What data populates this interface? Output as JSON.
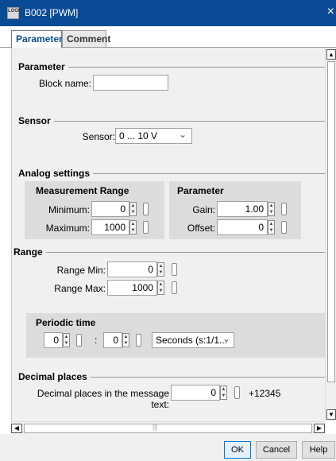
{
  "window": {
    "title": "B002 [PWM]",
    "app_icon": "LOGO",
    "close": "×"
  },
  "tabs": [
    {
      "label": "Parameter",
      "active": true
    },
    {
      "label": "Comment",
      "active": false
    }
  ],
  "sections": {
    "parameter": "Parameter",
    "sensor": "Sensor",
    "analog": "Analog settings",
    "range": "Range",
    "decimal": "Decimal places"
  },
  "fields": {
    "block_name": {
      "label": "Block name:",
      "value": ""
    },
    "sensor": {
      "label": "Sensor:",
      "value": "0 ... 10 V",
      "chevron": "⌄"
    },
    "measurement_range": {
      "title": "Measurement Range",
      "minimum": {
        "label": "Minimum:",
        "value": "0"
      },
      "maximum": {
        "label": "Maximum:",
        "value": "1000"
      }
    },
    "param_group": {
      "title": "Parameter",
      "gain": {
        "label": "Gain:",
        "value": "1.00"
      },
      "offset": {
        "label": "Offset:",
        "value": "0"
      }
    },
    "range_min": {
      "label": "Range Min:",
      "value": "0"
    },
    "range_max": {
      "label": "Range Max:",
      "value": "1000"
    },
    "periodic_time": {
      "title": "Periodic time",
      "value1": "0",
      "separator": ":",
      "value2": "0",
      "unit": "Seconds (s:1/1...",
      "chevron": "⌄"
    },
    "decimal_places": {
      "label": "Decimal places in the message text:",
      "value": "0",
      "preview": "+12345"
    }
  },
  "scroll": {
    "up": "▲",
    "down": "▼",
    "left": "◀",
    "right": "▶",
    "grip": "|||"
  },
  "buttons": {
    "ok": "OK",
    "cancel": "Cancel",
    "help": "Help"
  }
}
